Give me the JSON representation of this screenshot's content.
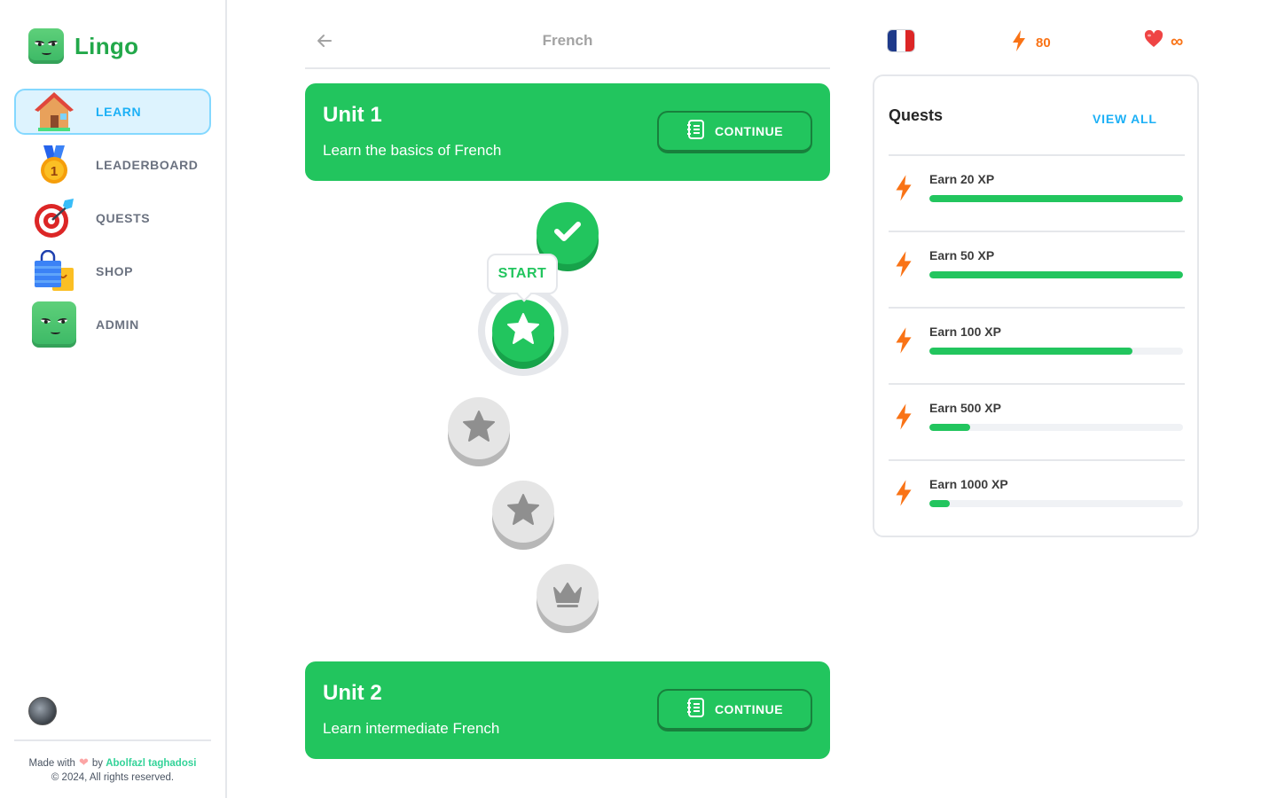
{
  "brand": {
    "name": "Lingo"
  },
  "sidebar": {
    "items": [
      {
        "label": "LEARN",
        "icon": "house-icon",
        "active": true
      },
      {
        "label": "LEADERBOARD",
        "icon": "medal-icon",
        "active": false
      },
      {
        "label": "QUESTS",
        "icon": "target-icon",
        "active": false
      },
      {
        "label": "SHOP",
        "icon": "shopping-bag-icon",
        "active": false
      },
      {
        "label": "ADMIN",
        "icon": "mascot-icon",
        "active": false
      }
    ],
    "footer": {
      "made_with": "Made with",
      "by": "by",
      "author": "Abolfazl taghadosi",
      "copyright": "© 2024, All rights reserved."
    }
  },
  "header": {
    "title": "French",
    "back_icon": "arrow-left-icon"
  },
  "units": [
    {
      "title": "Unit 1",
      "description": "Learn the basics of French",
      "button_label": "CONTINUE",
      "button_icon": "notebook-icon"
    },
    {
      "title": "Unit 2",
      "description": "Learn intermediate French",
      "button_label": "CONTINUE",
      "button_icon": "notebook-icon"
    }
  ],
  "lesson_path": {
    "start_label": "START",
    "lessons": [
      {
        "state": "completed",
        "icon": "check-icon"
      },
      {
        "state": "current",
        "icon": "star-icon"
      },
      {
        "state": "locked",
        "icon": "star-icon"
      },
      {
        "state": "locked",
        "icon": "star-icon"
      },
      {
        "state": "locked",
        "icon": "crown-icon"
      }
    ]
  },
  "stats": {
    "language_flag": "france-flag-icon",
    "xp": "80",
    "hearts": "∞",
    "colors": {
      "xp": "#f97316",
      "heart": "#ef4444"
    }
  },
  "quests": {
    "title": "Quests",
    "view_all": "VIEW ALL",
    "items": [
      {
        "label": "Earn 20 XP",
        "progress": 1.0
      },
      {
        "label": "Earn 50 XP",
        "progress": 1.0
      },
      {
        "label": "Earn 100 XP",
        "progress": 0.8
      },
      {
        "label": "Earn 500 XP",
        "progress": 0.16
      },
      {
        "label": "Earn 1000 XP",
        "progress": 0.08
      }
    ]
  },
  "colors": {
    "accent": "#22c55e",
    "link": "#1cb0f6",
    "active_bg": "#ddf3fe"
  }
}
